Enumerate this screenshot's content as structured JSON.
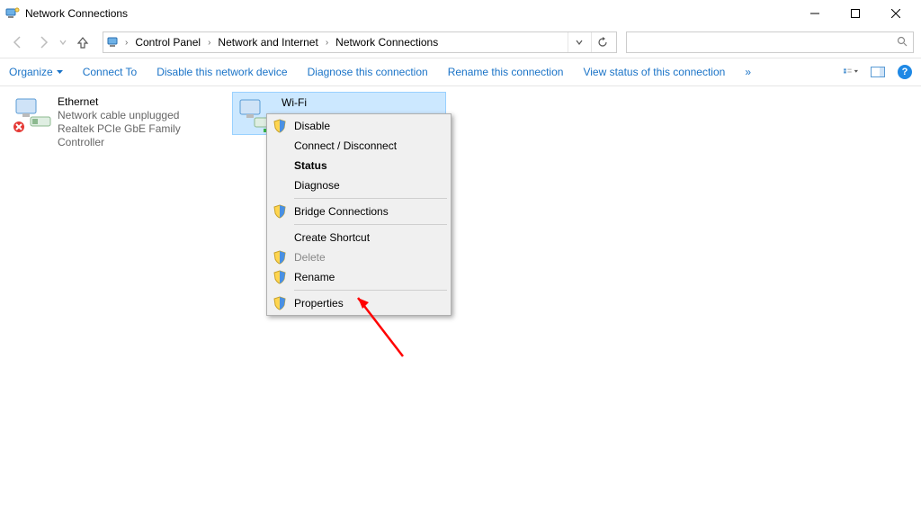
{
  "window": {
    "title": "Network Connections"
  },
  "breadcrumb": {
    "root_icon": "network-icon",
    "items": [
      "Control Panel",
      "Network and Internet",
      "Network Connections"
    ]
  },
  "search": {
    "placeholder": ""
  },
  "toolbar": {
    "organize": "Organize",
    "connect_to": "Connect To",
    "disable": "Disable this network device",
    "diagnose": "Diagnose this connection",
    "rename": "Rename this connection",
    "view_status": "View status of this connection",
    "overflow_glyph": "»"
  },
  "connections": {
    "ethernet": {
      "name": "Ethernet",
      "status": "Network cable unplugged",
      "adapter": "Realtek PCIe GbE Family Controller"
    },
    "wifi": {
      "name": "Wi-Fi"
    }
  },
  "context_menu": {
    "disable": "Disable",
    "connect_disconnect": "Connect / Disconnect",
    "status": "Status",
    "diagnose": "Diagnose",
    "bridge": "Bridge Connections",
    "create_shortcut": "Create Shortcut",
    "delete": "Delete",
    "rename": "Rename",
    "properties": "Properties"
  }
}
